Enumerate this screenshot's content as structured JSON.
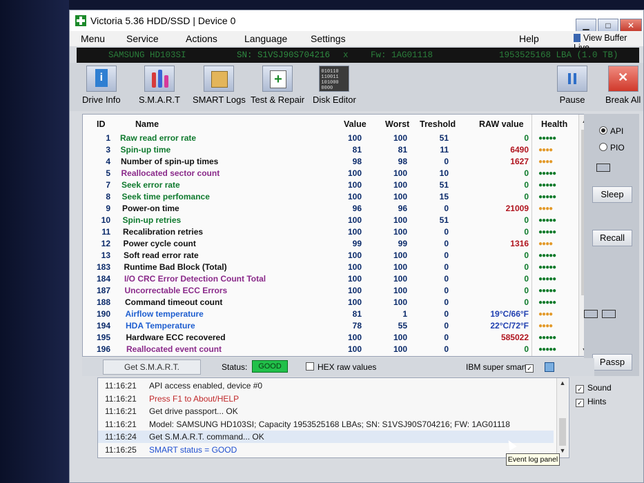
{
  "window": {
    "title": "Victoria 5.36 HDD/SSD | Device 0",
    "buttons": {
      "minimize": "▁",
      "maximize": "□",
      "close": "✕"
    }
  },
  "menu": {
    "items": [
      "Menu",
      "Service",
      "Actions",
      "Language",
      "Settings",
      "Help"
    ],
    "view_buffer": "View Buffer Live"
  },
  "drive": {
    "model": "SAMSUNG HD103SI",
    "serial": "SN: S1VSJ90S704216",
    "x": "x",
    "firmware": "Fw: 1AG01118",
    "capacity": "1953525168 LBA (1.0 TB)"
  },
  "toolbar": {
    "drive_info": "Drive Info",
    "smart": "S.M.A.R.T",
    "smart_logs": "SMART Logs",
    "test_repair": "Test & Repair",
    "disk_editor": "Disk Editor",
    "disk_editor_glyph": "010110\n110011\n101000\n0000",
    "pause": "Pause",
    "break_all": "Break All"
  },
  "smart_table": {
    "headers": {
      "id": "ID",
      "name": "Name",
      "value": "Value",
      "worst": "Worst",
      "threshold": "Treshold",
      "raw": "RAW value",
      "health": "Health"
    },
    "rows": [
      {
        "id": "1",
        "name": "Raw read error rate",
        "value": "100",
        "worst": "100",
        "threshold": "51",
        "raw": "0",
        "health": "●●●●●",
        "kind": "green"
      },
      {
        "id": "3",
        "name": "Spin-up time",
        "value": "81",
        "worst": "81",
        "threshold": "11",
        "raw": "6490",
        "health": "●●●●",
        "kind": "green"
      },
      {
        "id": "4",
        "name": "Number of spin-up times",
        "value": "98",
        "worst": "98",
        "threshold": "0",
        "raw": "1627",
        "health": "●●●●",
        "kind": "black"
      },
      {
        "id": "5",
        "name": "Reallocated sector count",
        "value": "100",
        "worst": "100",
        "threshold": "10",
        "raw": "0",
        "health": "●●●●●",
        "kind": "purple"
      },
      {
        "id": "7",
        "name": "Seek error rate",
        "value": "100",
        "worst": "100",
        "threshold": "51",
        "raw": "0",
        "health": "●●●●●",
        "kind": "green"
      },
      {
        "id": "8",
        "name": "Seek time perfomance",
        "value": "100",
        "worst": "100",
        "threshold": "15",
        "raw": "0",
        "health": "●●●●●",
        "kind": "green"
      },
      {
        "id": "9",
        "name": "Power-on time",
        "value": "96",
        "worst": "96",
        "threshold": "0",
        "raw": "21009",
        "health": "●●●●",
        "kind": "black"
      },
      {
        "id": "10",
        "name": "Spin-up retries",
        "value": "100",
        "worst": "100",
        "threshold": "51",
        "raw": "0",
        "health": "●●●●●",
        "kind": "green"
      },
      {
        "id": "11",
        "name": "Recalibration retries",
        "value": "100",
        "worst": "100",
        "threshold": "0",
        "raw": "0",
        "health": "●●●●●",
        "kind": "black"
      },
      {
        "id": "12",
        "name": "Power cycle count",
        "value": "99",
        "worst": "99",
        "threshold": "0",
        "raw": "1316",
        "health": "●●●●",
        "kind": "black"
      },
      {
        "id": "13",
        "name": "Soft read error rate",
        "value": "100",
        "worst": "100",
        "threshold": "0",
        "raw": "0",
        "health": "●●●●●",
        "kind": "black"
      },
      {
        "id": "183",
        "name": "Runtime Bad Block (Total)",
        "value": "100",
        "worst": "100",
        "threshold": "0",
        "raw": "0",
        "health": "●●●●●",
        "kind": "black"
      },
      {
        "id": "184",
        "name": "I/O CRC Error Detection Count Total",
        "value": "100",
        "worst": "100",
        "threshold": "0",
        "raw": "0",
        "health": "●●●●●",
        "kind": "purple"
      },
      {
        "id": "187",
        "name": "Uncorrectable ECC Errors",
        "value": "100",
        "worst": "100",
        "threshold": "0",
        "raw": "0",
        "health": "●●●●●",
        "kind": "purple"
      },
      {
        "id": "188",
        "name": "Command timeout count",
        "value": "100",
        "worst": "100",
        "threshold": "0",
        "raw": "0",
        "health": "●●●●●",
        "kind": "black"
      },
      {
        "id": "190",
        "name": "Airflow temperature",
        "value": "81",
        "worst": "1",
        "threshold": "0",
        "raw": "19°C/66°F",
        "health": "●●●●",
        "kind": "blue"
      },
      {
        "id": "194",
        "name": "HDA Temperature",
        "value": "78",
        "worst": "55",
        "threshold": "0",
        "raw": "22°C/72°F",
        "health": "●●●●",
        "kind": "blue"
      },
      {
        "id": "195",
        "name": "Hardware ECC recovered",
        "value": "100",
        "worst": "100",
        "threshold": "0",
        "raw": "585022",
        "health": "●●●●●",
        "kind": "black"
      },
      {
        "id": "196",
        "name": "Reallocated event count",
        "value": "100",
        "worst": "100",
        "threshold": "0",
        "raw": "0",
        "health": "●●●●●",
        "kind": "purple"
      }
    ]
  },
  "colors": {
    "green": "#0f7a2e",
    "black": "#111111",
    "purple": "#8a2a8a",
    "blue": "#1f5fd0",
    "raw_red": "#b0141e",
    "raw_blue": "#1f3fb0",
    "health_good": "#0d7a2a",
    "health_warn": "#e39a2a"
  },
  "side": {
    "api": "API",
    "pio": "PIO",
    "sleep": "Sleep",
    "recall": "Recall",
    "passp": "Passp"
  },
  "statusbar": {
    "get_smart": "Get S.M.A.R.T.",
    "status_label": "Status:",
    "status_value": "GOOD",
    "hex_raw": "HEX raw values",
    "ibm": "IBM super smart:",
    "ibm_check": "✓"
  },
  "log": [
    {
      "time": "11:16:21",
      "text": "API access enabled, device #0",
      "color": "#1a1a1a"
    },
    {
      "time": "11:16:21",
      "text": "Press F1 to About/HELP",
      "color": "#c0282a"
    },
    {
      "time": "11:16:21",
      "text": "Get drive passport... OK",
      "color": "#1a1a1a"
    },
    {
      "time": "11:16:21",
      "text": "Model: SAMSUNG HD103SI; Capacity 1953525168 LBAs; SN: S1VSJ90S704216; FW: 1AG01118",
      "color": "#1a1a1a"
    },
    {
      "time": "11:16:24",
      "text": "Get S.M.A.R.T. command... OK",
      "color": "#1a1a1a"
    },
    {
      "time": "11:16:25",
      "text": "SMART status = GOOD",
      "color": "#1f4fd0"
    }
  ],
  "options": {
    "sound": "Sound",
    "hints": "Hints"
  },
  "tooltip": "Event log panel"
}
